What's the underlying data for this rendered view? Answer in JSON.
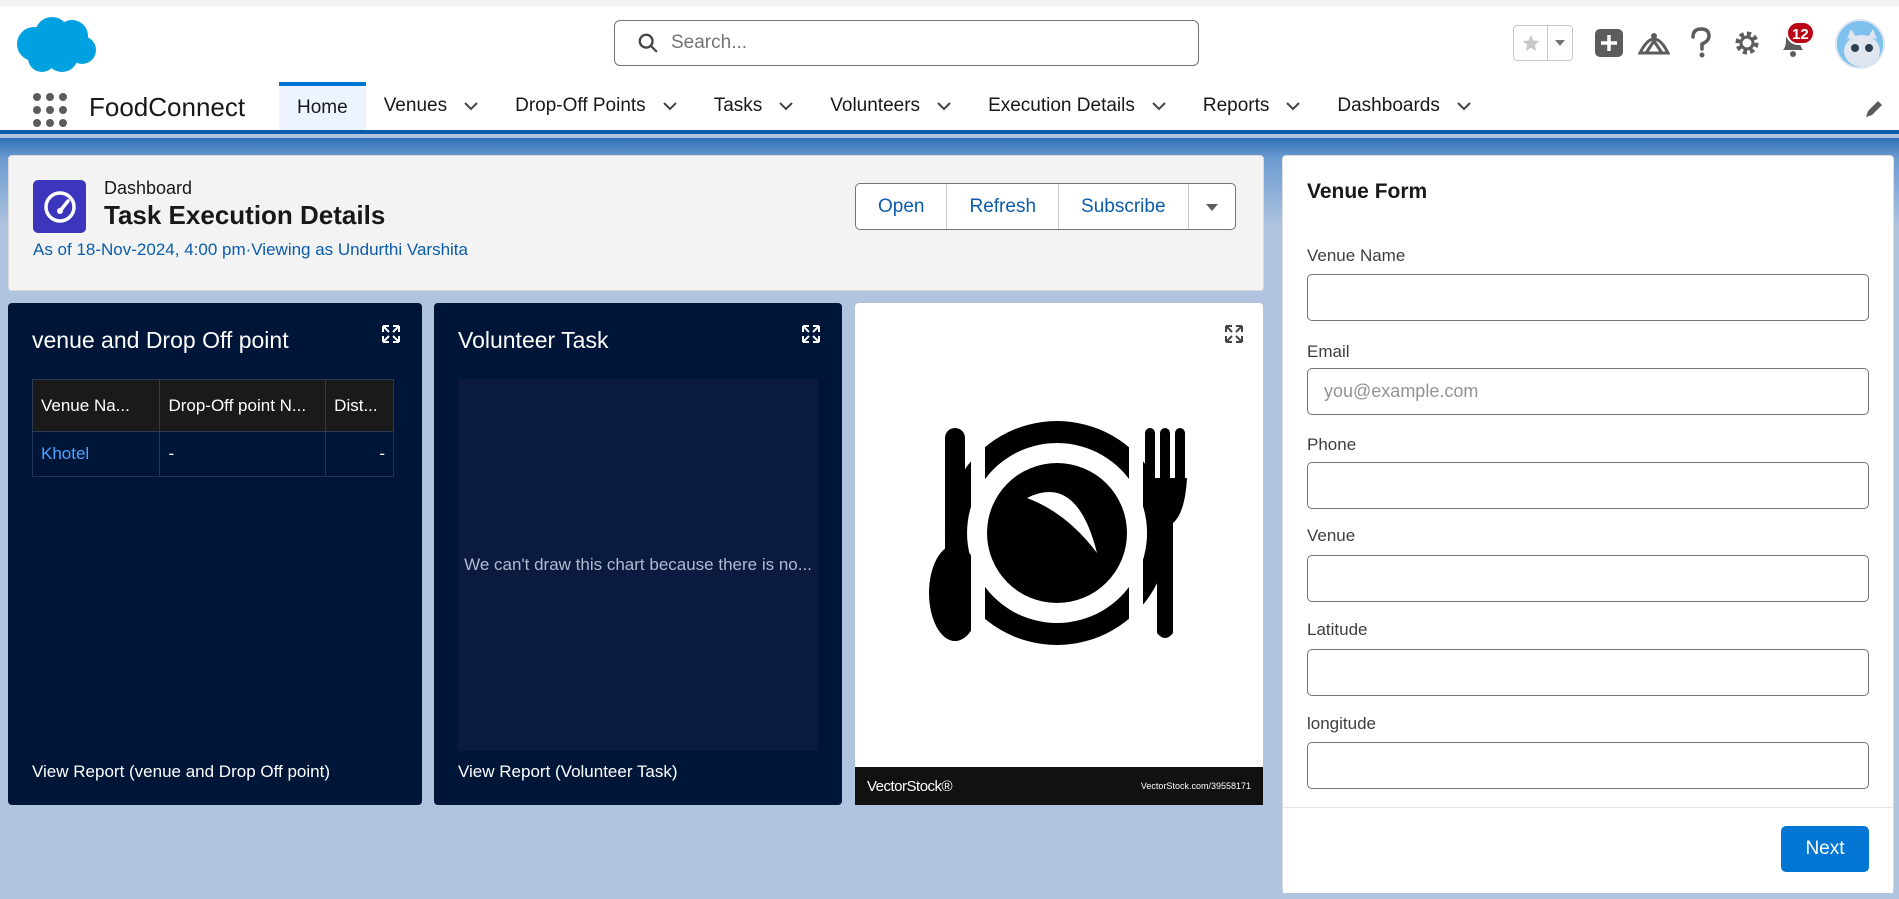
{
  "header": {
    "search_placeholder": "Search...",
    "notifications_count": "12"
  },
  "nav": {
    "app_name": "FoodConnect",
    "items": [
      {
        "label": "Home",
        "active": true
      },
      {
        "label": "Venues"
      },
      {
        "label": "Drop-Off Points"
      },
      {
        "label": "Tasks"
      },
      {
        "label": "Volunteers"
      },
      {
        "label": "Execution Details"
      },
      {
        "label": "Reports"
      },
      {
        "label": "Dashboards"
      }
    ]
  },
  "dashboard": {
    "eyebrow": "Dashboard",
    "title": "Task Execution Details",
    "subtitle": "As of 18-Nov-2024, 4:00 pm·Viewing as Undurthi Varshita",
    "buttons": {
      "open": "Open",
      "refresh": "Refresh",
      "subscribe": "Subscribe"
    }
  },
  "widgets": {
    "venue_dropoff": {
      "title": "venue and Drop Off point",
      "columns": [
        "Venue Na...",
        "Drop-Off point N...",
        "Dist..."
      ],
      "rows": [
        [
          "Khotel",
          "-",
          "-"
        ]
      ],
      "link": "View Report (venue and Drop Off point)"
    },
    "volunteer_task": {
      "title": "Volunteer Task",
      "empty_message": "We can't draw this chart because there is no...",
      "link": "View Report (Volunteer Task)"
    },
    "image": {
      "watermark_logo": "VectorStock®",
      "watermark_id": "VectorStock.com/39558171"
    }
  },
  "venue_form": {
    "title": "Venue Form",
    "fields": {
      "venue_name": {
        "label": "Venue Name",
        "value": "",
        "placeholder": ""
      },
      "email": {
        "label": "Email",
        "value": "",
        "placeholder": "you@example.com"
      },
      "phone": {
        "label": "Phone",
        "value": "",
        "placeholder": ""
      },
      "venue": {
        "label": "Venue",
        "value": "",
        "placeholder": ""
      },
      "latitude": {
        "label": "Latitude",
        "value": "",
        "placeholder": ""
      },
      "longitude": {
        "label": "longitude",
        "value": "",
        "placeholder": ""
      }
    },
    "next_label": "Next"
  },
  "colors": {
    "brand_blue": "#0176d3",
    "link_blue": "#0b5cab",
    "widget_bg": "#001639",
    "badge_red": "#ba0517",
    "dashboard_icon": "#3c36bd"
  }
}
